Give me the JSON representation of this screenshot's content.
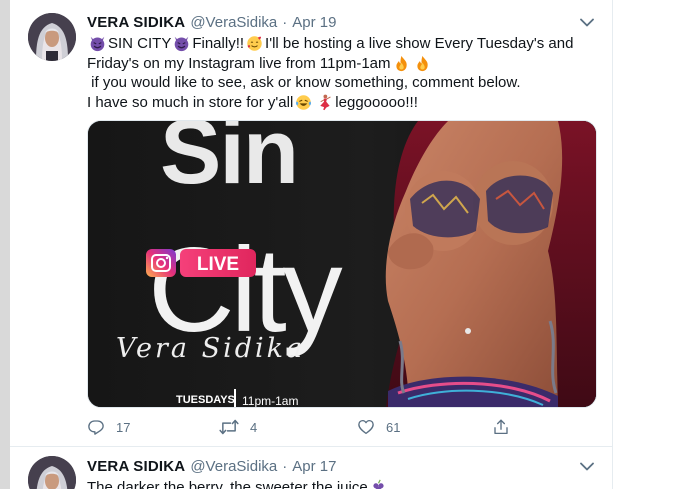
{
  "colors": {
    "text_primary": "#0f1419",
    "text_secondary": "#5b7083",
    "divider": "#e6ecf0",
    "live_badge": "#e8336b",
    "fire_emoji": "#f4900c",
    "devil_emoji": "#744eaa"
  },
  "tweets": [
    {
      "author_name": "VERA SIDIKA",
      "author_handle": "@VeraSidika",
      "separator": "·",
      "date": "Apr 19",
      "menu_icon": "chevron-down-icon",
      "text_lines": [
        {
          "parts": [
            "SIN CITY",
            "Finally!!",
            "I'll be hosting a live show Every Tuesday's and"
          ]
        },
        {
          "parts": [
            "Friday's on my Instagram live from 11pm-1am"
          ]
        },
        {
          "parts": [
            " if you would like to see, ask or know something, comment below."
          ]
        },
        {
          "parts": [
            "I have so much in store for y'all",
            "leggooooo!!!"
          ]
        }
      ],
      "media": {
        "title_partial": "Sin",
        "title_main": "City",
        "badge_label": "LIVE",
        "signature": "Vera Sidika",
        "footer_left": "TUESDAYS",
        "footer_right": "11pm-1am",
        "badge_icon": "instagram-icon"
      },
      "actions": {
        "reply_count": "17",
        "retweet_count": "4",
        "like_count": "61"
      }
    },
    {
      "author_name": "VERA SIDIKA",
      "author_handle": "@VeraSidika",
      "separator": "·",
      "date": "Apr 17",
      "menu_icon": "chevron-down-icon",
      "text_preview": "The darker the berry, the sweeter the juice"
    }
  ]
}
